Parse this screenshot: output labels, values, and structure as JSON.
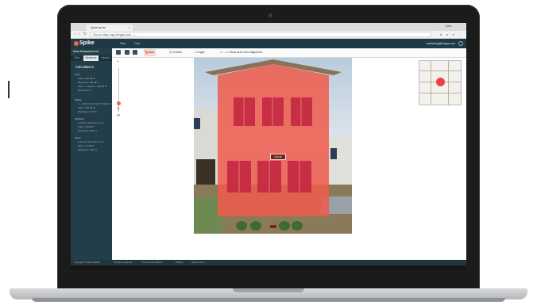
{
  "browser": {
    "tab_title": "Spike by Ike",
    "tab_close": "×",
    "window_user": "Spike",
    "nav": {
      "back": "‹",
      "forward": "›",
      "reload": "↻"
    },
    "url_secure": "Secure",
    "url_text": "https://app.ikegps.com/…/…"
  },
  "app": {
    "logo": "Spike",
    "menu": [
      "Files",
      "Help"
    ],
    "account": "marketing@ikegps.com"
  },
  "sidebar": {
    "title": "New Measurement",
    "tabs": [
      "Files",
      "Measures",
      "Hazard"
    ],
    "active_tab": "Measures",
    "calculations_title": "Calculations",
    "lines": [
      "Total",
      "Area = 260.48 ft²",
      "Perimeter = 68.48 ft",
      "Area – 7 objects = 160.26 ft²",
      "Openings = 0",
      "Siding",
      "1 – 3.47 ft² 2.6 ft² 3.47 ft² 4.21 ft²",
      "Area = 160.48 ft²",
      "Perimeter = 71.6 ft",
      "Windows",
      "1.4 ft² 2.7 ft² 2.4 ft² 1.1 ft²",
      "Area = 18.96 ft²",
      "Perimeter = 48.1 ft",
      "Doors",
      "1.4 ft² 2.7 ft² 2.4 ft² 1.1 ft²",
      "Area = 17.36 ft²",
      "Perimeter = 38.1 ft"
    ]
  },
  "toolbar": {
    "area_label": "Area",
    "extract_label": "Extract",
    "length_label": "Length",
    "alignment_label": "Show area from alignment"
  },
  "canvas": {
    "measure_label": "160.26"
  },
  "footer": {
    "copyright": "Copyright © 2017 ikeGPS",
    "rights": "All rights reserved",
    "terms": "Terms & Conditions",
    "privacy": "Privacy",
    "version": "Version 2.1.1"
  },
  "colors": {
    "brand": "#f06a3b",
    "overlay": "#f05a4b",
    "sidebar": "#233e48"
  }
}
